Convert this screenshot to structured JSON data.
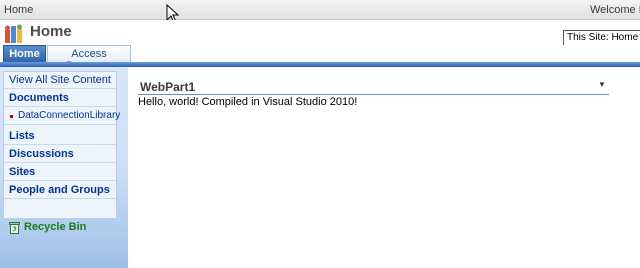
{
  "topbar": {
    "breadcrumb": "Home",
    "welcome": "Welcome MC"
  },
  "site": {
    "title": "Home"
  },
  "search": {
    "scope_value": "This Site: Home"
  },
  "tabs": [
    {
      "label": "Home",
      "selected": true
    },
    {
      "label": "Access Requests",
      "selected": false
    }
  ],
  "quicklaunch": {
    "view_all": "View All Site Content",
    "documents": "Documents",
    "data_connection_library": "DataConnectionLibrary",
    "lists": "Lists",
    "discussions": "Discussions",
    "sites": "Sites",
    "people_and_groups": "People and Groups",
    "recycle_bin": "Recycle Bin"
  },
  "webpart": {
    "title": "WebPart1",
    "menu_glyph": "▼",
    "body": "Hello, world! Compiled in Visual Studio 2010!"
  },
  "colors": {
    "accent_blue": "#2f64ad",
    "link_blue": "#003399",
    "recycle_green": "#1a7a1a",
    "nav_background": "#d8e6f7"
  },
  "icons": {
    "logo": "sharepoint-logo-icon",
    "recycle": "recycle-bin-icon",
    "cursor": "mouse-cursor-icon",
    "menu": "dropdown-arrow-icon"
  }
}
